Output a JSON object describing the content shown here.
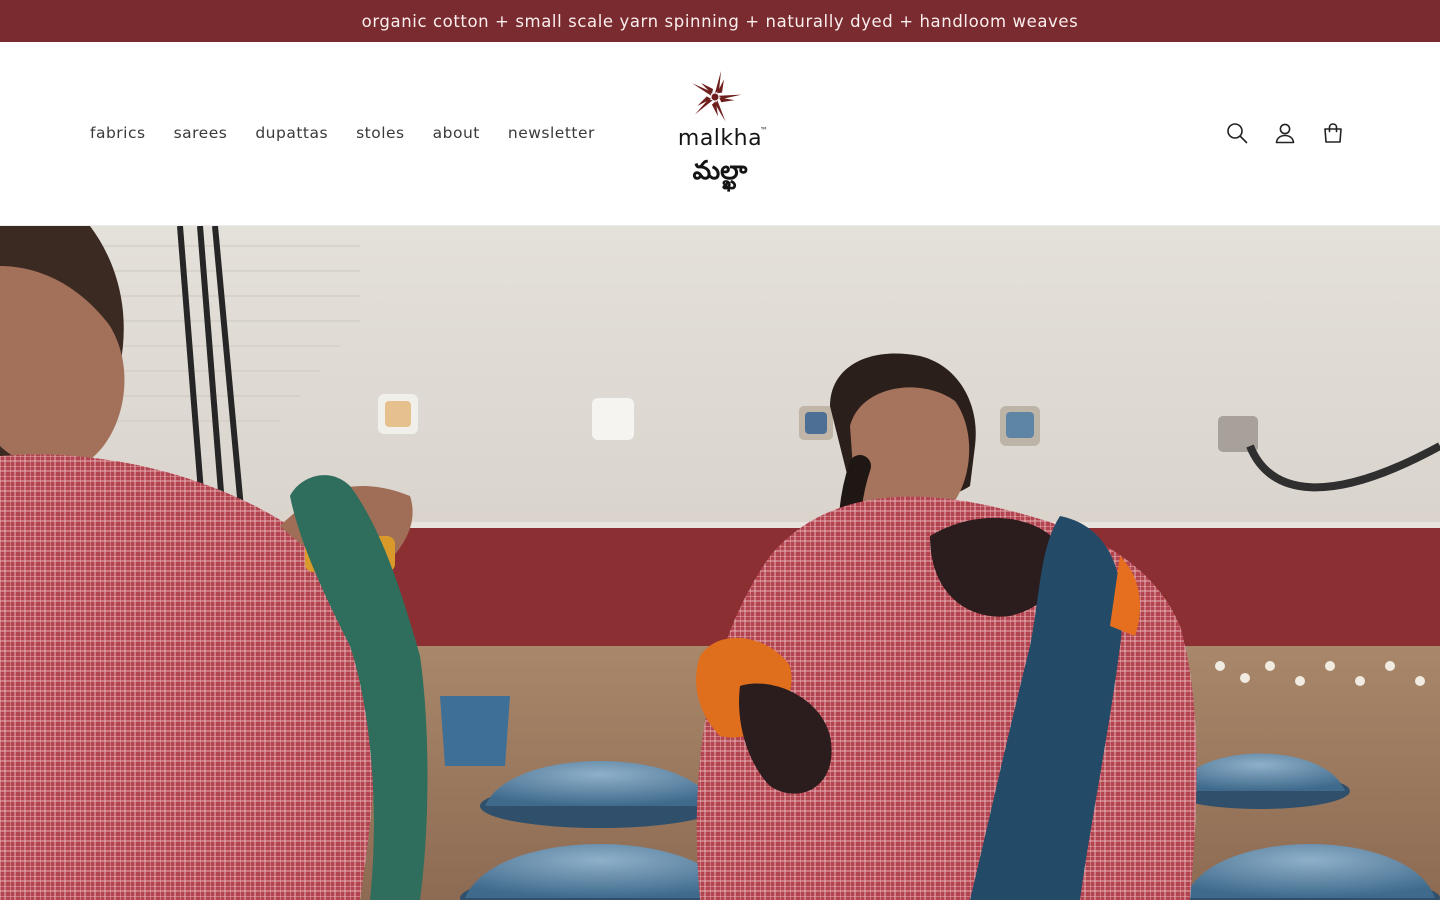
{
  "announcement": {
    "text": "organic cotton + small scale yarn spinning + naturally dyed + handloom weaves"
  },
  "nav": {
    "items": [
      {
        "label": "fabrics"
      },
      {
        "label": "sarees"
      },
      {
        "label": "dupattas"
      },
      {
        "label": "stoles"
      },
      {
        "label": "about"
      },
      {
        "label": "newsletter"
      }
    ]
  },
  "logo": {
    "brand_latin": "malkha",
    "tm": "™",
    "brand_script": "మల్ఖా"
  },
  "header_icons": [
    {
      "icon": "search-icon"
    },
    {
      "icon": "account-icon"
    },
    {
      "icon": "cart-icon"
    }
  ],
  "colors": {
    "announcement_bg": "#7a2b30",
    "logo_mark": "#6e1e1c"
  }
}
